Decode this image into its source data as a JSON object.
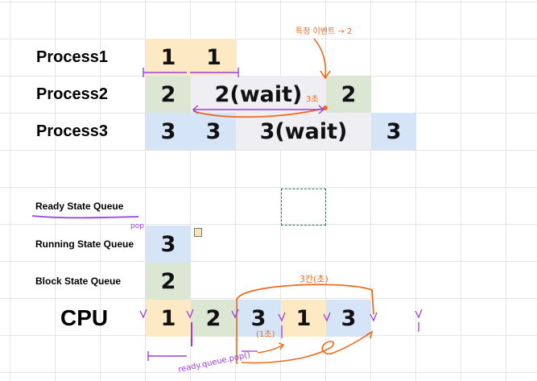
{
  "rows": {
    "process1": "Process1",
    "process2": "Process2",
    "process3": "Process3",
    "ready": "Ready State Queue",
    "running": "Running State Queue",
    "block": "Block State Queue",
    "cpu": "CPU"
  },
  "cells": {
    "p1": [
      "1",
      "1"
    ],
    "p2": [
      "2",
      "2(wait)",
      "2"
    ],
    "p3": [
      "3",
      "3",
      "3(wait)",
      "3"
    ],
    "running": "3",
    "block": "2",
    "cpu": [
      "1",
      "2",
      "3",
      "1",
      "3"
    ]
  },
  "annotations": {
    "event": "특정 이벤트 → 2",
    "three_sec": "3초",
    "three_cells": "3칸(초)",
    "pop": "pop",
    "ready_pop": "ready.queue.pop()",
    "one_sec": "(1초)"
  },
  "colors": {
    "yellow": "#fde9c4",
    "green": "#dbe7d3",
    "blue": "#d5e4f6",
    "gray": "#efeef2",
    "orange_ink": "#f06a1c",
    "purple_ink": "#9b3fe0"
  }
}
